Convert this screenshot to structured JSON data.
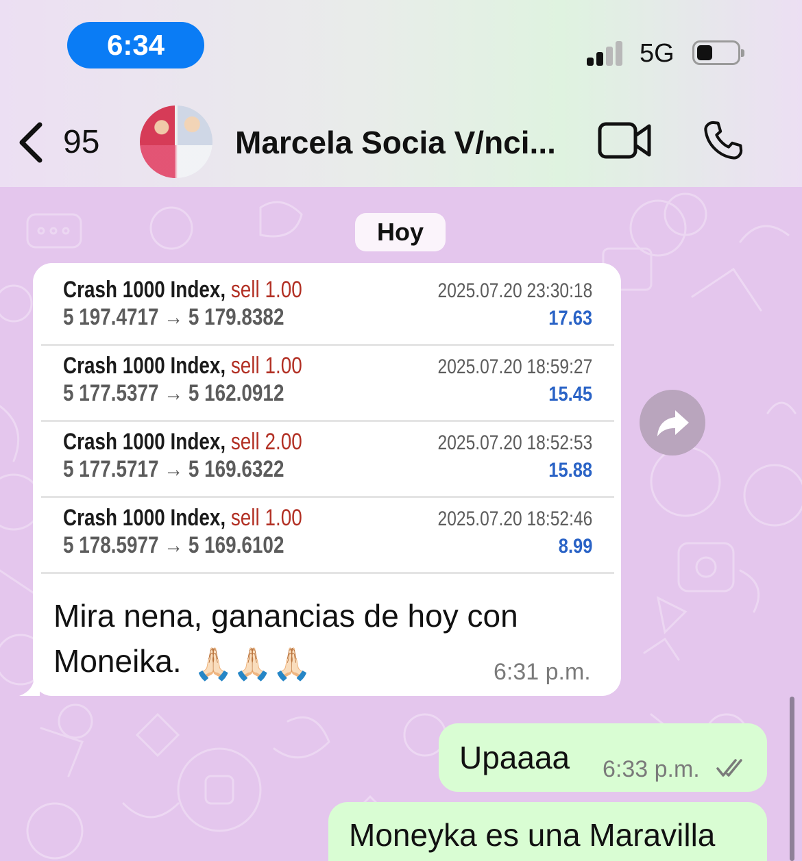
{
  "status_bar": {
    "time": "6:34",
    "network": "5G"
  },
  "header": {
    "back_count": "95",
    "contact_name": "Marcela Socia V/nci..."
  },
  "chat": {
    "day_label": "Hoy",
    "incoming": {
      "trades": [
        {
          "instrument": "Crash 1000 Index,",
          "action": "sell 1.00",
          "prices": "5 197.4717 → 5 179.8382",
          "datetime": "2025.07.20 23:30:18",
          "profit": "17.63"
        },
        {
          "instrument": "Crash 1000 Index,",
          "action": "sell 1.00",
          "prices": "5 177.5377 → 5 162.0912",
          "datetime": "2025.07.20 18:59:27",
          "profit": "15.45"
        },
        {
          "instrument": "Crash 1000 Index,",
          "action": "sell 2.00",
          "prices": "5 177.5717 → 5 169.6322",
          "datetime": "2025.07.20 18:52:53",
          "profit": "15.88"
        },
        {
          "instrument": "Crash 1000 Index,",
          "action": "sell 1.00",
          "prices": "5 178.5977 → 5 169.6102",
          "datetime": "2025.07.20 18:52:46",
          "profit": "8.99"
        }
      ],
      "text_line1": "Mira nena, ganancias de hoy con",
      "text_line2": "Moneika.",
      "emoji": "🙏🏻🙏🏻🙏🏻",
      "time": "6:31 p.m."
    },
    "outgoing": [
      {
        "text": "Upaaaa",
        "time": "6:33 p.m."
      },
      {
        "text": "Moneyka es una Maravilla"
      }
    ]
  }
}
